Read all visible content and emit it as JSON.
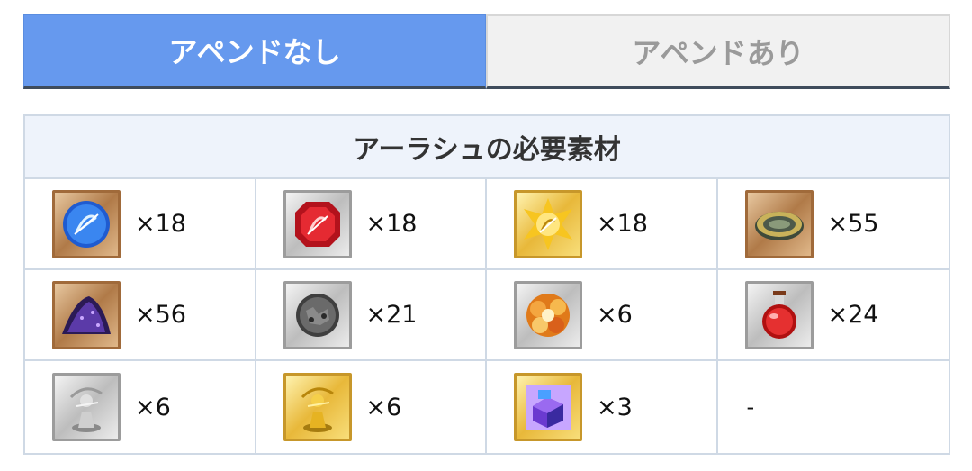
{
  "tabs": [
    {
      "label": "アペンドなし",
      "active": true
    },
    {
      "label": "アペンドあり",
      "active": false
    }
  ],
  "panel": {
    "title": "アーラシュの必要素材",
    "materials": [
      {
        "icon": "saber-piece-archer-icon",
        "frame": "bronze",
        "qty": "×18"
      },
      {
        "icon": "red-gem-archer-icon",
        "frame": "silver",
        "qty": "×18"
      },
      {
        "icon": "gold-gem-archer-icon",
        "frame": "gold",
        "qty": "×18"
      },
      {
        "icon": "medal-disc-icon",
        "frame": "bronze",
        "qty": "×55"
      },
      {
        "icon": "purple-crystal-pile-icon",
        "frame": "bronze",
        "qty": "×56"
      },
      {
        "icon": "gray-ore-stone-icon",
        "frame": "silver",
        "qty": "×21"
      },
      {
        "icon": "orange-flower-cluster-icon",
        "frame": "silver",
        "qty": "×6"
      },
      {
        "icon": "red-potion-flask-icon",
        "frame": "silver",
        "qty": "×24"
      },
      {
        "icon": "silver-archer-statue-icon",
        "frame": "silver",
        "qty": "×6"
      },
      {
        "icon": "gold-archer-statue-icon",
        "frame": "gold",
        "qty": "×6"
      },
      {
        "icon": "purple-crystal-cube-icon",
        "frame": "gold",
        "qty": "×3"
      },
      {
        "icon": "",
        "frame": "",
        "qty": "-"
      }
    ]
  },
  "colors": {
    "tab_active_bg": "#6699ee",
    "tab_inactive_bg": "#f1f1f1",
    "header_bg": "#eef3fb",
    "grid_border": "#cfd9e5"
  }
}
